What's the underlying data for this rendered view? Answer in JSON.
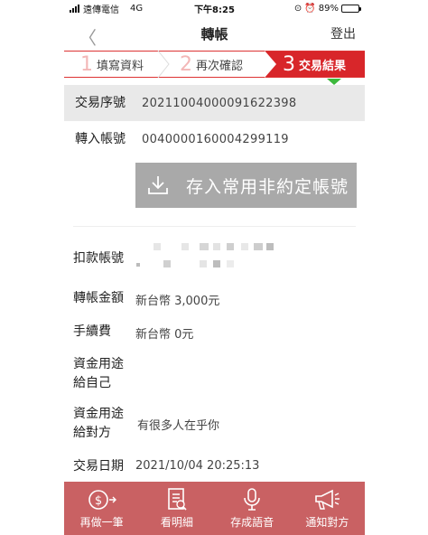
{
  "status_bar": {
    "carrier": "遠傳電信",
    "network": "4G",
    "time": "下午8:25",
    "battery": "89%",
    "battery_level": 0.89
  },
  "nav": {
    "title": "轉帳",
    "back_icon": "chevron-left-icon",
    "logout_label": "登出"
  },
  "steps": [
    {
      "num": "1",
      "label": "填寫資料"
    },
    {
      "num": "2",
      "label": "再次確認"
    },
    {
      "num": "3",
      "label": "交易結果"
    }
  ],
  "result": {
    "seq_label": "交易序號",
    "seq_value": "20211004000091622398",
    "to_account_label": "轉入帳號",
    "to_account_value": "0040000160004299119",
    "save_button_label": "存入常用非約定帳號",
    "debit_account_label": "扣款帳號",
    "amount_label": "轉帳金額",
    "amount_value": "新台幣 3,000元",
    "fee_label": "手續費",
    "fee_value": "新台幣 0元",
    "purpose_self_label_1": "資金用途",
    "purpose_self_label_2": "給自己",
    "purpose_other_label_1": "資金用途",
    "purpose_other_label_2": "給對方",
    "purpose_other_value": "有很多人在乎你",
    "date_label": "交易日期",
    "date_value": "2021/10/04 20:25:13"
  },
  "bottom_bar": [
    {
      "label": "再做一筆",
      "icon": "money-transfer-icon"
    },
    {
      "label": "看明細",
      "icon": "document-icon"
    },
    {
      "label": "存成語音",
      "icon": "microphone-icon"
    },
    {
      "label": "通知對方",
      "icon": "megaphone-icon"
    }
  ],
  "colors": {
    "brand_red": "#d8262a",
    "bottom_bar": "#c96163",
    "active_marker": "#3db93d",
    "save_button": "#a9a9a9"
  }
}
